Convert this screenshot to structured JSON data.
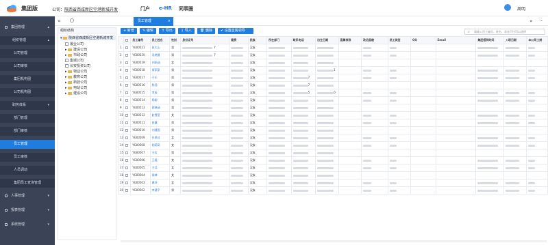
{
  "header": {
    "brand": "集团版",
    "company_prefix": "公司：",
    "company_value": "陕西省西咸新区空港新城开发",
    "nav": [
      "门户",
      "e-HR",
      "同事圈"
    ],
    "user": "周明"
  },
  "sidebar": {
    "items": [
      {
        "label": "集团管理",
        "kind": "top"
      },
      {
        "label": "组织管理",
        "kind": "sub"
      },
      {
        "label": "公司管理",
        "kind": "leaf"
      },
      {
        "label": "公司审核",
        "kind": "leaf"
      },
      {
        "label": "集团机构图",
        "kind": "leaf"
      },
      {
        "label": "公司机构图",
        "kind": "leaf"
      },
      {
        "label": "职务体系",
        "kind": "sub"
      },
      {
        "label": "部门管理",
        "kind": "leaf"
      },
      {
        "label": "部门审核",
        "kind": "leaf"
      },
      {
        "label": "员工管理",
        "kind": "active"
      },
      {
        "label": "员工审核",
        "kind": "leaf"
      },
      {
        "label": "人员调动",
        "kind": "leaf"
      },
      {
        "label": "集团员工查询管理",
        "kind": "leaf"
      },
      {
        "label": "人事管理",
        "kind": "top"
      },
      {
        "label": "报表管理",
        "kind": "top"
      },
      {
        "label": "系统管理",
        "kind": "top"
      }
    ]
  },
  "tabs": {
    "active": "员工管理"
  },
  "tree": {
    "title": "组织结构",
    "root": "陕西省西咸新区空港新城开发",
    "nodes": [
      "置业公司",
      "建设公司",
      "市政公司",
      "集城公司",
      "长安投资公司",
      "物业公司",
      "教育公司",
      "新技公司",
      "电站公司",
      "建设公司"
    ]
  },
  "toolbar": {
    "buttons": [
      "新增",
      "编辑",
      "导出",
      "导入",
      "删除",
      "设置直属领导"
    ],
    "search_placeholder": "请输入员工编号、姓名、状态下拉可以选择"
  },
  "table": {
    "headers": [
      "",
      "",
      "员工编号",
      "员工姓名",
      "性别",
      "身份证号",
      "籍贯",
      "民族",
      "所在部门",
      "联系电话",
      "出生日期",
      "直属领导",
      "政治面貌",
      "员工类型",
      "QQ",
      "Email",
      "集团报到时间",
      "入职日期",
      "本公司工龄"
    ],
    "rows": [
      {
        "no": "1",
        "id": "YG00521",
        "name": "张大山",
        "sex": "男",
        "idtail": "7",
        "nation": "汉族",
        "dept": "",
        "phone": "",
        "birth": ""
      },
      {
        "no": "2",
        "id": "YG00520",
        "name": "吴晓晨",
        "sex": "男",
        "idtail": "7",
        "nation": "汉族",
        "dept": "",
        "phone": "",
        "birth": ""
      },
      {
        "no": "3",
        "id": "YG00519",
        "name": "刘雨涵",
        "sex": "女",
        "idtail": "",
        "nation": "汉族",
        "dept": "",
        "phone": "",
        "birth": ""
      },
      {
        "no": "4",
        "id": "YG00518",
        "name": "周家豪",
        "sex": "男",
        "idtail": "",
        "nation": "汉族",
        "dept": "",
        "phone": "",
        "birth": "1"
      },
      {
        "no": "5",
        "id": "YG00517",
        "name": "于乐",
        "sex": "男",
        "idtail": "",
        "nation": "汉族",
        "dept": "",
        "phone": "7",
        "birth": ""
      },
      {
        "no": "6",
        "id": "YG00516",
        "name": "陈瑶",
        "sex": "男",
        "idtail": "",
        "nation": "汉族",
        "dept": "",
        "phone": "7",
        "birth": ""
      },
      {
        "no": "7",
        "id": "YG00515",
        "name": "李辰",
        "sex": "男",
        "idtail": "",
        "nation": "汉族",
        "dept": "",
        "phone": "5",
        "birth": "0"
      },
      {
        "no": "8",
        "id": "YG00514",
        "name": "杨柳",
        "sex": "男",
        "idtail": "",
        "nation": "汉族",
        "dept": "",
        "phone": "",
        "birth": ""
      },
      {
        "no": "9",
        "id": "YG00513",
        "name": "郭晓涵",
        "sex": "男",
        "idtail": "",
        "nation": "汉族",
        "dept": "",
        "phone": "",
        "birth": ""
      },
      {
        "no": "10",
        "id": "YG00512",
        "name": "赵雪莹",
        "sex": "女",
        "idtail": "",
        "nation": "汉族",
        "dept": "",
        "phone": "",
        "birth": ""
      },
      {
        "no": "11",
        "id": "YG00511",
        "name": "张露",
        "sex": "男",
        "idtail": "",
        "nation": "汉族",
        "dept": "",
        "phone": "",
        "birth": ""
      },
      {
        "no": "12",
        "id": "YG00510",
        "name": "刘建国",
        "sex": "男",
        "idtail": "",
        "nation": "汉族",
        "dept": "",
        "phone": "",
        "birth": ""
      },
      {
        "no": "13",
        "id": "YG00509",
        "name": "孙思佳",
        "sex": "女",
        "idtail": "",
        "nation": "汉族",
        "dept": "",
        "phone": "",
        "birth": ""
      },
      {
        "no": "14",
        "id": "YG00508",
        "name": "胡萌萌",
        "sex": "女",
        "idtail": "",
        "nation": "汉族",
        "dept": "",
        "phone": "",
        "birth": ""
      },
      {
        "no": "15",
        "id": "YG00507",
        "name": "王芳",
        "sex": "男",
        "idtail": "",
        "nation": "汉族",
        "dept": "",
        "phone": "",
        "birth": ""
      },
      {
        "no": "16",
        "id": "YG00506",
        "name": "王磊",
        "sex": "女",
        "idtail": "",
        "nation": "汉族",
        "dept": "",
        "phone": "",
        "birth": ""
      },
      {
        "no": "17",
        "id": "YG00505",
        "name": "王浩",
        "sex": "女",
        "idtail": "",
        "nation": "汉族",
        "dept": "",
        "phone": "",
        "birth": ""
      },
      {
        "no": "18",
        "id": "YG00504",
        "name": "周婷",
        "sex": "女",
        "idtail": "",
        "nation": "汉族",
        "dept": "",
        "phone": "",
        "birth": ""
      },
      {
        "no": "19",
        "id": "YG00503",
        "name": "黄轩",
        "sex": "女",
        "idtail": "",
        "nation": "汉族",
        "dept": "",
        "phone": "",
        "birth": ""
      },
      {
        "no": "20",
        "id": "YG00502",
        "name": "李建平",
        "sex": "男",
        "idtail": "",
        "nation": "汉族",
        "dept": "",
        "phone": "",
        "birth": ""
      }
    ]
  },
  "colors": {
    "accent": "#1f7de0",
    "sidebar": "#3b4457"
  }
}
